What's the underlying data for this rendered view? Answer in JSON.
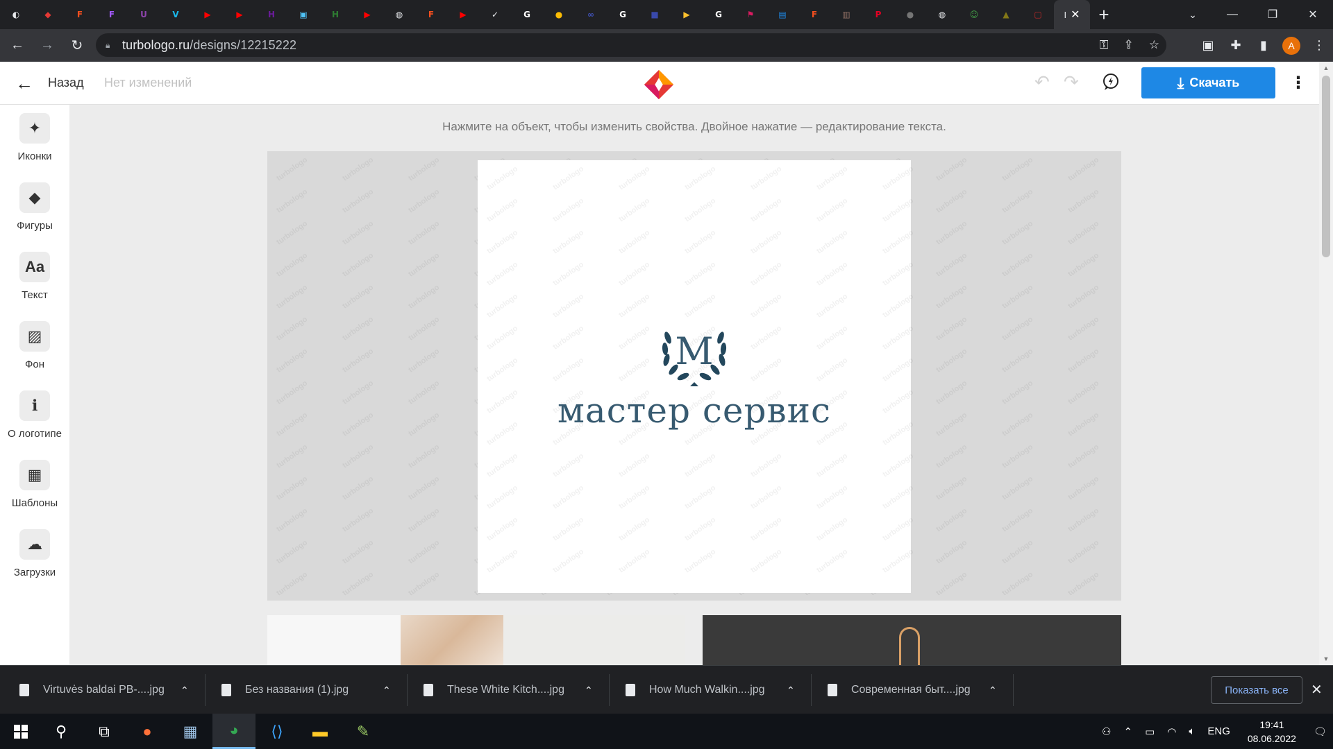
{
  "browser": {
    "tabs": [
      {
        "icon": "chrome-icon",
        "color": "#e8eaed",
        "glyph": "◐"
      },
      {
        "icon": "turbologo-icon",
        "color": "#e53935",
        "glyph": "◆"
      },
      {
        "icon": "figma-icon",
        "color": "#f24e1e",
        "glyph": "F"
      },
      {
        "icon": "figma-icon",
        "color": "#a259ff",
        "glyph": "F"
      },
      {
        "icon": "uplabs-icon",
        "color": "#8e44ad",
        "glyph": "U"
      },
      {
        "icon": "vimeo-icon",
        "color": "#1ab7ea",
        "glyph": "V"
      },
      {
        "icon": "youtube-icon",
        "color": "#ff0000",
        "glyph": "▶"
      },
      {
        "icon": "youtube-icon",
        "color": "#ff0000",
        "glyph": "▶"
      },
      {
        "icon": "h-icon",
        "color": "#6a1b9a",
        "glyph": "H"
      },
      {
        "icon": "app-icon",
        "color": "#4fc3f7",
        "glyph": "▣"
      },
      {
        "icon": "h-icon",
        "color": "#2e7d32",
        "glyph": "H"
      },
      {
        "icon": "youtube-icon",
        "color": "#ff0000",
        "glyph": "▶"
      },
      {
        "icon": "globe-icon",
        "color": "#e8eaed",
        "glyph": "◍"
      },
      {
        "icon": "figma-icon",
        "color": "#f24e1e",
        "glyph": "F"
      },
      {
        "icon": "youtube-icon",
        "color": "#ff0000",
        "glyph": "▶"
      },
      {
        "icon": "nike-icon",
        "color": "#e8eaed",
        "glyph": "✓"
      },
      {
        "icon": "google-icon",
        "color": "#ffffff",
        "glyph": "G"
      },
      {
        "icon": "circle-icon",
        "color": "#fbbc04",
        "glyph": "●"
      },
      {
        "icon": "loop-icon",
        "color": "#3f51b5",
        "glyph": "∞"
      },
      {
        "icon": "google-icon",
        "color": "#ffffff",
        "glyph": "G"
      },
      {
        "icon": "app-icon",
        "color": "#3949ab",
        "glyph": "■"
      },
      {
        "icon": "play-icon",
        "color": "#fbc02d",
        "glyph": "▶"
      },
      {
        "icon": "google-icon",
        "color": "#ffffff",
        "glyph": "G"
      },
      {
        "icon": "flag-icon",
        "color": "#d81b60",
        "glyph": "⚑"
      },
      {
        "icon": "image-icon",
        "color": "#1e88e5",
        "glyph": "▤"
      },
      {
        "icon": "figma-icon",
        "color": "#f24e1e",
        "glyph": "F"
      },
      {
        "icon": "book-icon",
        "color": "#8d6e63",
        "glyph": "▥"
      },
      {
        "icon": "pinterest-icon",
        "color": "#e60023",
        "glyph": "P"
      },
      {
        "icon": "drop-icon",
        "color": "#757575",
        "glyph": "●"
      },
      {
        "icon": "globe-icon",
        "color": "#e8eaed",
        "glyph": "◍"
      },
      {
        "icon": "smile-icon",
        "color": "#43a047",
        "glyph": "☺"
      },
      {
        "icon": "tree-icon",
        "color": "#827717",
        "glyph": "▲"
      },
      {
        "icon": "app-icon",
        "color": "#c62828",
        "glyph": "▢"
      }
    ],
    "active_tab_glyph": "I",
    "address": {
      "host": "turbologo.ru",
      "path": "/designs/12215222"
    },
    "profile_initial": "A"
  },
  "app": {
    "back_label": "Назад",
    "status": "Нет изменений",
    "download_label": "Скачать",
    "hint": "Нажмите на объект, чтобы изменить свойства. Двойное нажатие — редактирование текста.",
    "tools": [
      {
        "name": "icons",
        "label": "Иконки",
        "glyph": "✦"
      },
      {
        "name": "shapes",
        "label": "Фигуры",
        "glyph": "◆"
      },
      {
        "name": "text",
        "label": "Текст",
        "glyph": "Aa"
      },
      {
        "name": "background",
        "label": "Фон",
        "glyph": "▨"
      },
      {
        "name": "about-logo",
        "label": "О логотипе",
        "glyph": "ℹ"
      },
      {
        "name": "templates",
        "label": "Шаблоны",
        "glyph": "▦"
      },
      {
        "name": "uploads",
        "label": "Загрузки",
        "glyph": "☁"
      }
    ],
    "logo": {
      "monogram": "M",
      "text": "мастер сервис",
      "color": "#375a70"
    },
    "watermark": "turbologo"
  },
  "downloads": {
    "items": [
      "Virtuvės baldai PB-....jpg",
      "Без названия (1).jpg",
      "These White Kitch....jpg",
      "How Much Walkin....jpg",
      "Современная быт....jpg"
    ],
    "show_all": "Показать все"
  },
  "taskbar": {
    "lang": "ENG",
    "time": "19:41",
    "date": "08.06.2022",
    "notifications": "1"
  },
  "colors": {
    "accent": "#1e88e5"
  }
}
